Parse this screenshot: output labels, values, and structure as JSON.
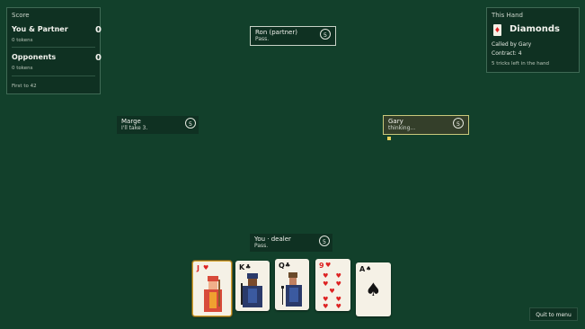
{
  "score_panel": {
    "title": "Score",
    "team1": {
      "name": "You & Partner",
      "points": "0",
      "tokens": "0 tokens"
    },
    "team2": {
      "name": "Opponents",
      "points": "0",
      "tokens": "0 tokens"
    },
    "footer": "First to 42"
  },
  "hand_panel": {
    "title": "This Hand",
    "suit_icon": "diamond-card-icon",
    "suit_glyph": "♦",
    "suit": "Diamonds",
    "called_by": "Called by Gary",
    "contract": "Contract: 4",
    "tricks_left": "5 tricks left in the hand"
  },
  "players": {
    "top": {
      "name": "Ron (partner)",
      "status": "Pass.",
      "cards": "5"
    },
    "left": {
      "name": "Marge",
      "status": "I'll take 3.",
      "cards": "5"
    },
    "right": {
      "name": "Gary",
      "status": "thinking...",
      "cards": "5"
    },
    "bottom": {
      "name": "You · dealer",
      "status": "Pass.",
      "cards": "5"
    }
  },
  "player_hand": [
    {
      "rank": "J",
      "suit_glyph": "♥",
      "suit": "hearts",
      "color": "#d22",
      "selected": true
    },
    {
      "rank": "K",
      "suit_glyph": "♣",
      "suit": "clubs",
      "color": "#141414"
    },
    {
      "rank": "Q",
      "suit_glyph": "♣",
      "suit": "clubs",
      "color": "#141414"
    },
    {
      "rank": "9",
      "suit_glyph": "♥",
      "suit": "hearts",
      "color": "#d22"
    },
    {
      "rank": "A",
      "suit_glyph": "♠",
      "suit": "spades",
      "color": "#141414"
    }
  ],
  "quit_button": "Quit to menu"
}
